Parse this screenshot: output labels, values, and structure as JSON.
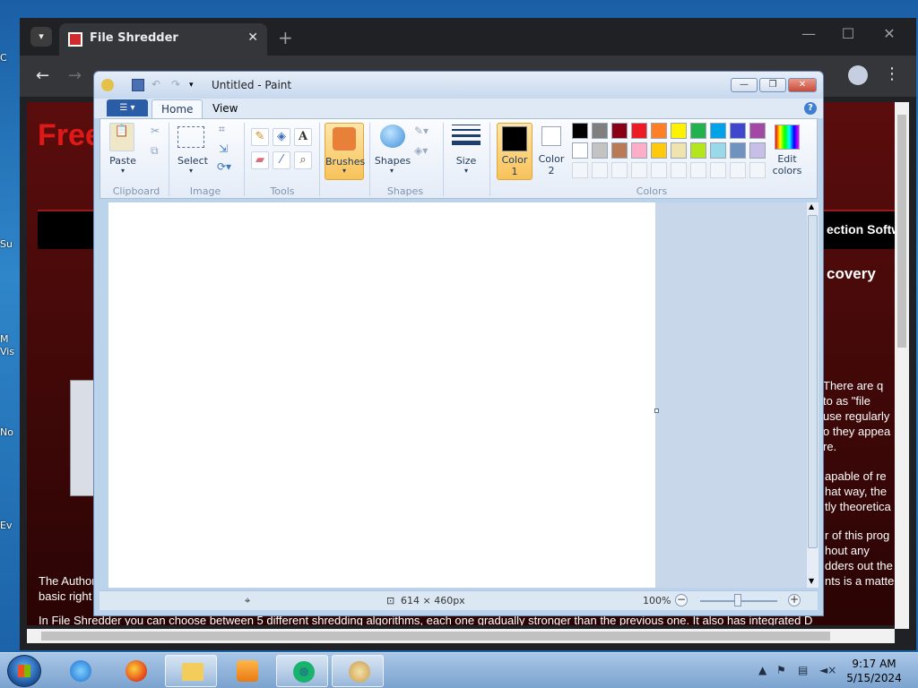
{
  "desktop": {
    "icon_labels": [
      "C",
      "Su",
      "M",
      "Vis",
      "No",
      "Ev"
    ]
  },
  "browser": {
    "tab_title": "File Shredder",
    "tab_close": "✕",
    "new_tab": "+",
    "window_buttons": {
      "minimize": "—",
      "maximize": "☐",
      "close": "✕"
    },
    "nav": {
      "back": "←",
      "forward": "→"
    },
    "menu": "⋮"
  },
  "webpage": {
    "logo_text": "Free",
    "nav_right": "ection Softw",
    "heading_right": "covery",
    "left_red_text": "F",
    "right_paragraph_1": [
      " There are q",
      " to as \"file",
      "use regularly",
      "o they appea",
      "re."
    ],
    "right_paragraph_2": [
      "apable of re",
      "hat way, the ",
      "tly theoretica"
    ],
    "right_paragraph_3": [
      "r of this prog",
      "hout any",
      "dders out the",
      "nts is a matte"
    ],
    "author_line_1": "The Author b",
    "author_line_2": "basic right to",
    "bottom_line": "In File Shredder you can choose between 5 different shredding algorithms, each one gradually stronger than the previous one. It also has integrated D"
  },
  "paint": {
    "title": "Untitled - Paint",
    "window_buttons": {
      "minimize": "—",
      "maximize": "❐",
      "close": "✕"
    },
    "tabs": [
      "Home",
      "View"
    ],
    "groups": {
      "clipboard": {
        "label": "Clipboard",
        "paste": "Paste"
      },
      "image": {
        "label": "Image",
        "select": "Select"
      },
      "tools": {
        "label": "Tools"
      },
      "brushes": {
        "label": "Brushes"
      },
      "shapes": {
        "label": "Shapes",
        "shapes_btn": "Shapes"
      },
      "size": {
        "label": "Size"
      },
      "colors": {
        "label": "Colors",
        "color1": [
          "Color",
          "1"
        ],
        "color2": [
          "Color",
          "2"
        ],
        "edit": [
          "Edit",
          "colors"
        ],
        "row1": [
          "#000000",
          "#7f7f7f",
          "#880015",
          "#ed1c24",
          "#ff7f27",
          "#fff200",
          "#22b14c",
          "#00a2e8",
          "#3f48cc",
          "#a349a4"
        ],
        "row2": [
          "#ffffff",
          "#c3c3c3",
          "#b97a57",
          "#ffaec9",
          "#ffc90e",
          "#efe4b0",
          "#b5e61d",
          "#99d9ea",
          "#7092be",
          "#c8bfe7"
        ]
      }
    },
    "status": {
      "canvas_size": "614 × 460px",
      "zoom": "100%",
      "zoom_out": "−",
      "zoom_in": "+"
    },
    "help": "?"
  },
  "taskbar": {
    "time": "9:17 AM",
    "date": "5/15/2024"
  }
}
